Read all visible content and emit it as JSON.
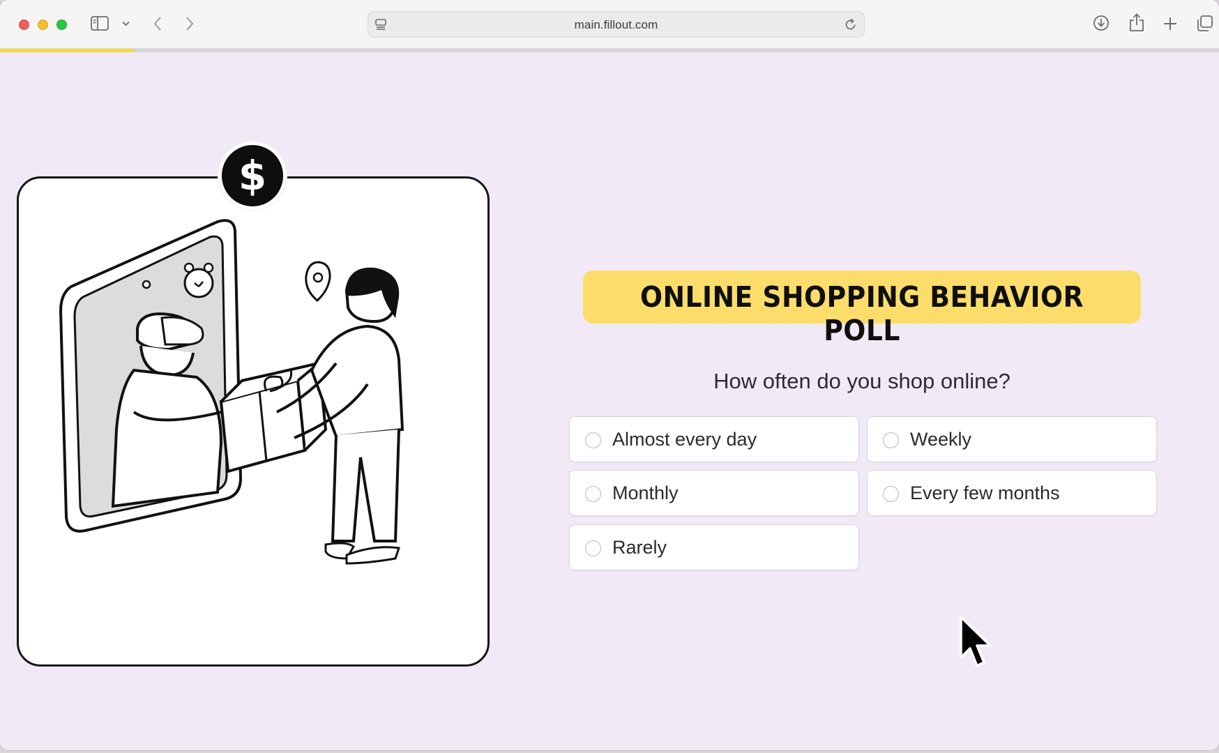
{
  "browser": {
    "url": "main.fillout.com",
    "progress_percent": 11
  },
  "poll": {
    "title": "ONLINE SHOPPING BEHAVIOR POLL",
    "question": "How often do you shop online?",
    "options": [
      {
        "label": "Almost every day"
      },
      {
        "label": "Weekly"
      },
      {
        "label": "Monthly"
      },
      {
        "label": "Every few months"
      },
      {
        "label": "Rarely"
      }
    ]
  },
  "illustration": {
    "badge_symbol": "$"
  },
  "colors": {
    "page_background": "#f1eaf6",
    "title_highlight": "#fcdd6b",
    "progress_bar": "#f5d74a"
  },
  "icons": [
    "sidebar-icon",
    "chevron-down-icon",
    "back-icon",
    "forward-icon",
    "page-menu-icon",
    "reload-icon",
    "download-icon",
    "share-icon",
    "new-tab-icon",
    "tab-overview-icon",
    "dollar-icon",
    "location-pin-icon",
    "alarm-clock-icon",
    "mouse-pointer-icon"
  ]
}
